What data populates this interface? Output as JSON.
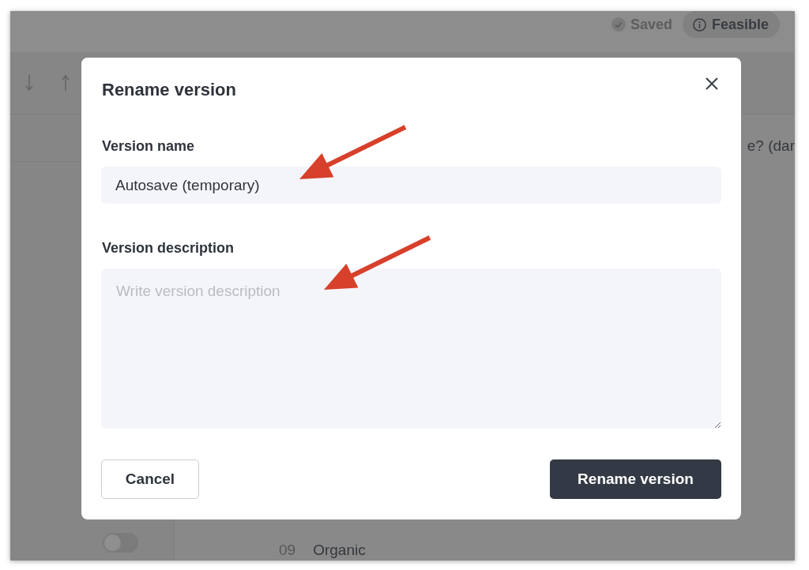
{
  "app": {
    "header": {
      "save_status": "Saved",
      "feasibility": "Feasible"
    },
    "left_panel": {
      "toggle": {
        "on": false
      }
    },
    "main": {
      "question_fragment": "e? (dar",
      "row": {
        "number": "09",
        "label": "Organic"
      }
    }
  },
  "dialog": {
    "title": "Rename version",
    "fields": [
      {
        "kind": "input",
        "label": "Version name",
        "value": "Autosave (temporary)",
        "arrow_callout": true
      },
      {
        "kind": "textarea",
        "label": "Version description",
        "placeholder": "Write version description",
        "arrow_callout": true
      }
    ],
    "buttons": [
      {
        "kind": "secondary",
        "label": "Cancel"
      },
      {
        "kind": "primary",
        "label": "Rename version"
      }
    ]
  }
}
